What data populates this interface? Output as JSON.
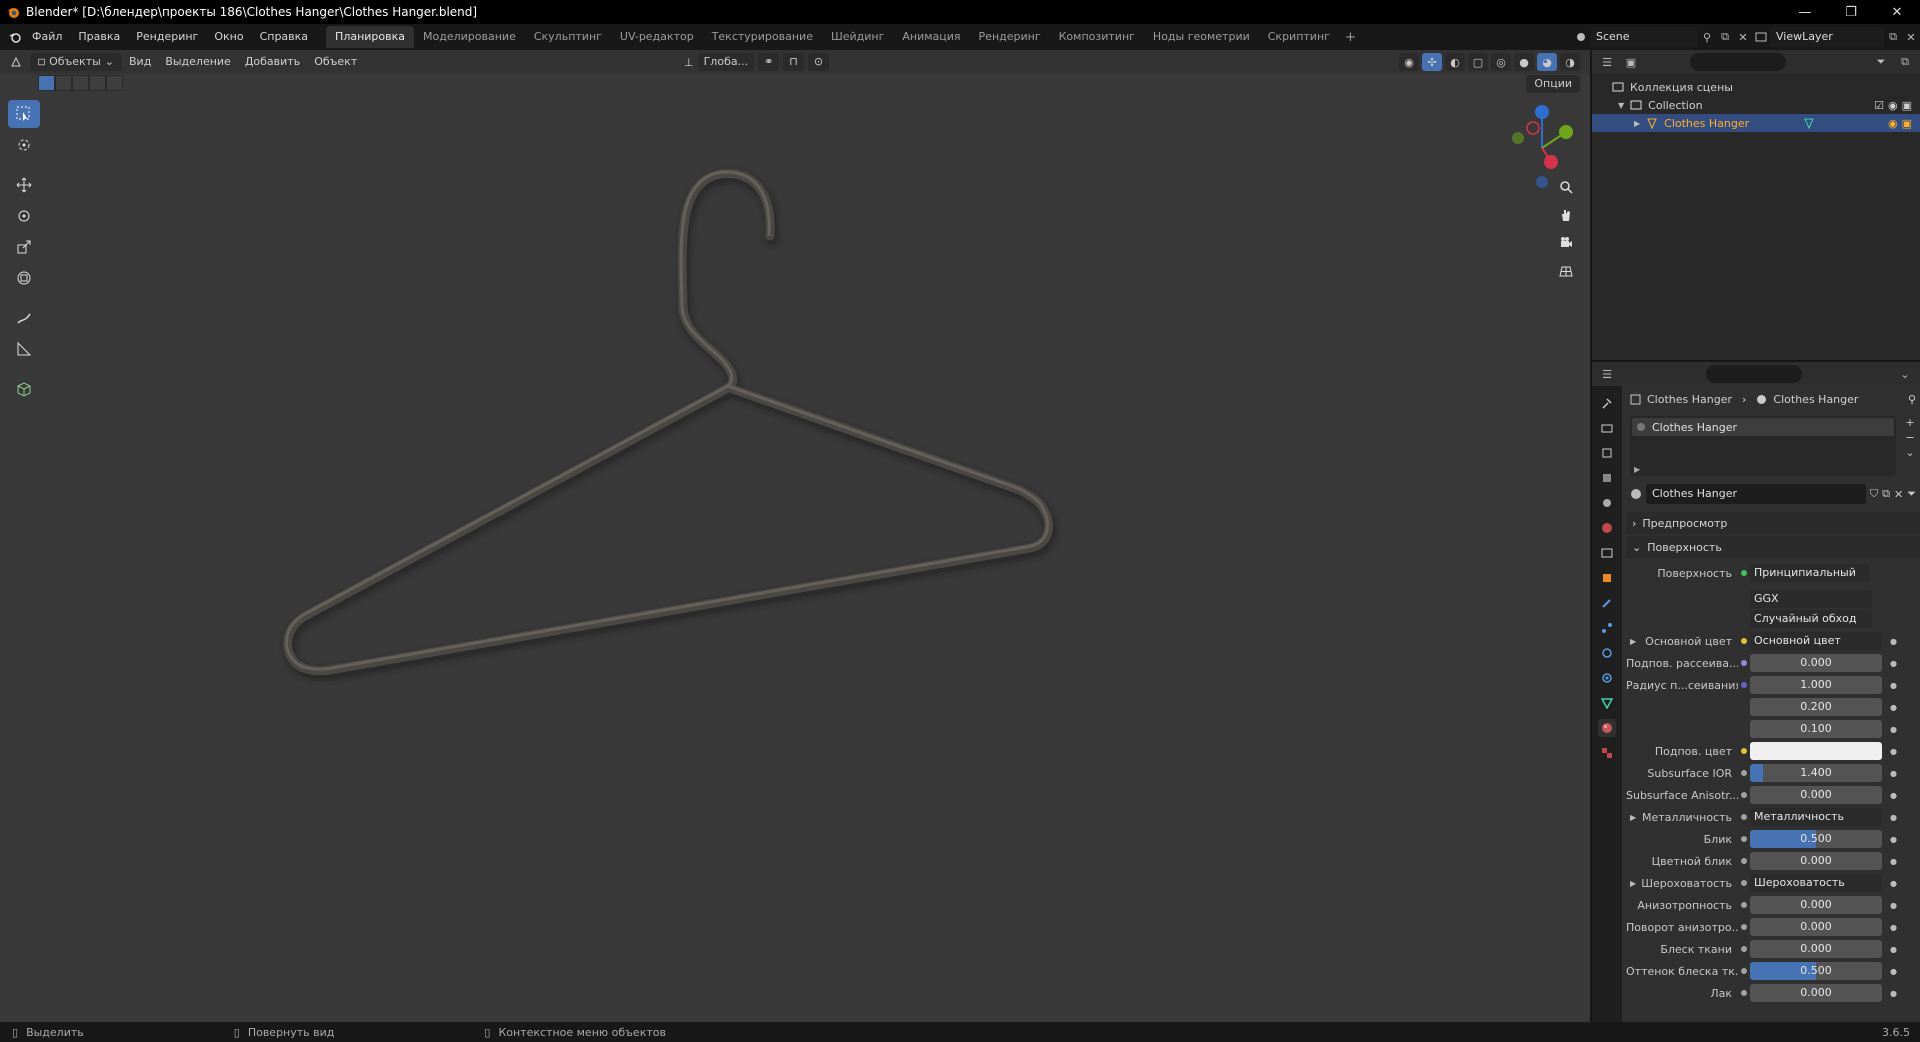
{
  "window": {
    "title": "Blender* [D:\\блендер\\проекты 186\\Clothes Hanger\\Clothes Hanger.blend]",
    "controls": [
      "—",
      "❐",
      "✕"
    ]
  },
  "menu": [
    "Файл",
    "Правка",
    "Рендеринг",
    "Окно",
    "Справка"
  ],
  "workspaces": [
    {
      "label": "Планировка",
      "active": true
    },
    {
      "label": "Моделирование",
      "active": false
    },
    {
      "label": "Скульптинг",
      "active": false
    },
    {
      "label": "UV-редактор",
      "active": false
    },
    {
      "label": "Текстурирование",
      "active": false
    },
    {
      "label": "Шейдинг",
      "active": false
    },
    {
      "label": "Анимация",
      "active": false
    },
    {
      "label": "Рендеринг",
      "active": false
    },
    {
      "label": "Композитинг",
      "active": false
    },
    {
      "label": "Ноды геометрии",
      "active": false
    },
    {
      "label": "Скриптинг",
      "active": false
    }
  ],
  "workspace_add": "+",
  "scene": "Scene",
  "view_layer": "ViewLayer",
  "viewport": {
    "mode": "Объекты",
    "menus": [
      "Вид",
      "Выделение",
      "Добавить",
      "Объект"
    ],
    "transform_orientation": "Глоба...",
    "options": "Опции"
  },
  "outliner": {
    "root": "Коллекция сцены",
    "collection": "Collection",
    "object": "Clothes Hanger"
  },
  "properties": {
    "breadcrumb": [
      "Clothes Hanger",
      "Clothes Hanger"
    ],
    "material_slot": "Clothes Hanger",
    "material_name": "Clothes Hanger",
    "panels": {
      "preview": "Предпросмотр",
      "surface": "Поверхность"
    },
    "surface_label": "Поверхность",
    "surface_shader": "Принципиальный BSDF",
    "distribution": "GGX",
    "subsurface_method": "Случайный обход",
    "rows": [
      {
        "label": "Основной цвет",
        "value": "Основной цвет",
        "kind": "link",
        "dot": "#e3c13a",
        "expander": true
      },
      {
        "label": "Подпов. рассеива...",
        "value": "0.000",
        "kind": "num",
        "dot": "#8f8fd6",
        "fill": 0
      },
      {
        "label": "Радиус п...сеивания",
        "value": "1.000",
        "kind": "num",
        "dot": "#6363c7",
        "fill": 0
      },
      {
        "label": "",
        "value": "0.200",
        "kind": "num",
        "dot": "",
        "fill": 0
      },
      {
        "label": "",
        "value": "0.100",
        "kind": "num",
        "dot": "",
        "fill": 0
      },
      {
        "label": "Подпов. цвет",
        "value": "",
        "kind": "color",
        "dot": "#e3c13a",
        "swatch": "#f0f0f0"
      },
      {
        "label": "Subsurface IOR",
        "value": "1.400",
        "kind": "num",
        "dot": "#a1a1a1",
        "fill": 0.1
      },
      {
        "label": "Subsurface Anisotr...",
        "value": "0.000",
        "kind": "num",
        "dot": "#a1a1a1",
        "fill": 0
      },
      {
        "label": "Металличность",
        "value": "Металличность",
        "kind": "link",
        "dot": "#a1a1a1",
        "expander": true
      },
      {
        "label": "Блик",
        "value": "0.500",
        "kind": "num",
        "dot": "#a1a1a1",
        "fill": 0.5
      },
      {
        "label": "Цветной блик",
        "value": "0.000",
        "kind": "num",
        "dot": "#a1a1a1",
        "fill": 0
      },
      {
        "label": "Шероховатость",
        "value": "Шероховатость",
        "kind": "link",
        "dot": "#a1a1a1",
        "expander": true
      },
      {
        "label": "Анизотропность",
        "value": "0.000",
        "kind": "num",
        "dot": "#a1a1a1",
        "fill": 0
      },
      {
        "label": "Поворот анизотро...",
        "value": "0.000",
        "kind": "num",
        "dot": "#a1a1a1",
        "fill": 0
      },
      {
        "label": "Блеск ткани",
        "value": "0.000",
        "kind": "num",
        "dot": "#a1a1a1",
        "fill": 0
      },
      {
        "label": "Оттенок блеска тк...",
        "value": "0.500",
        "kind": "num",
        "dot": "#a1a1a1",
        "fill": 0.5
      },
      {
        "label": "Лак",
        "value": "0.000",
        "kind": "num",
        "dot": "#a1a1a1",
        "fill": 0
      }
    ]
  },
  "statusbar": {
    "select": "Выделить",
    "rotate": "Повернуть вид",
    "context": "Контекстное меню объектов",
    "version": "3.6.5"
  },
  "colors": {
    "accent": "#4772b3",
    "selected_text": "#ffaf29",
    "viewport_bg": "#393939"
  }
}
